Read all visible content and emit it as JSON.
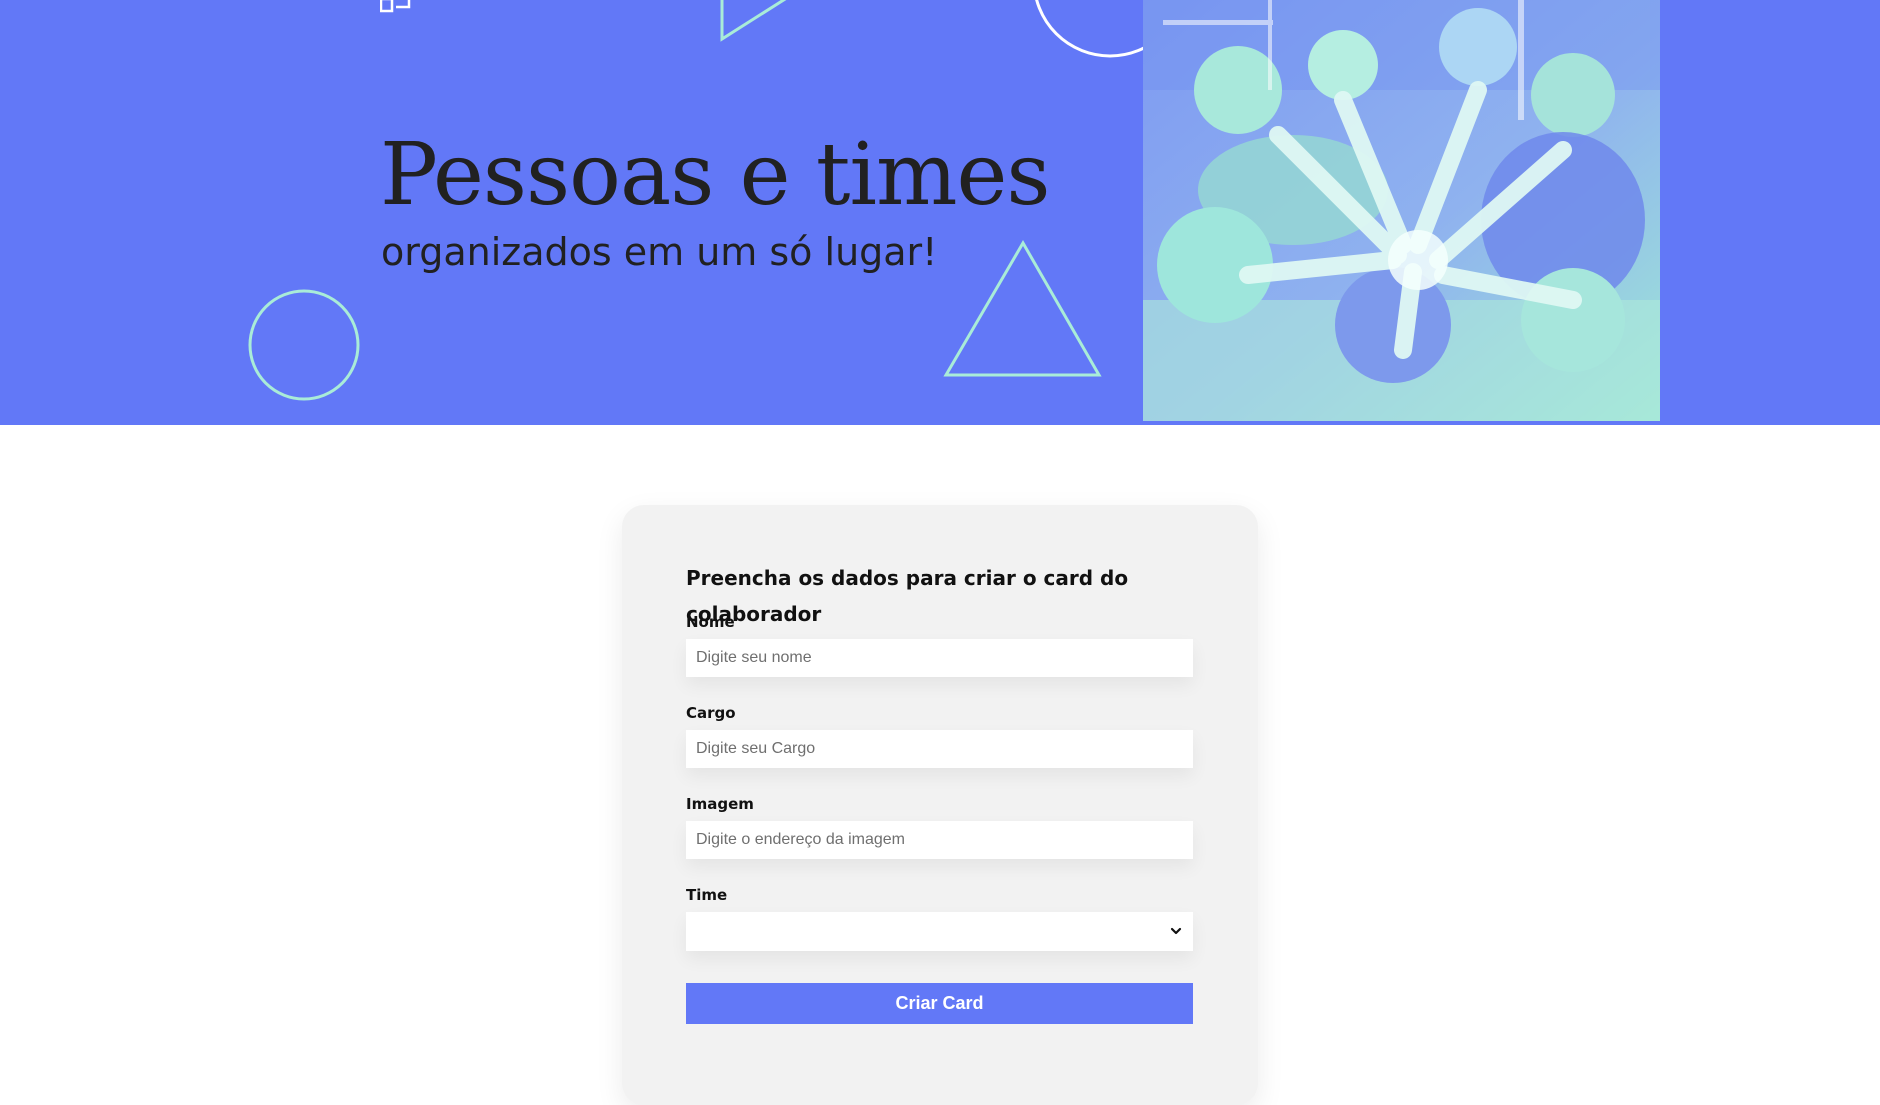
{
  "banner": {
    "title": "Pessoas e times",
    "subtitle": "organizados em um só lugar!",
    "background_color": "#6278f7",
    "accent_color": "#a9ecd8",
    "photo": "team-hands-together-photo"
  },
  "form": {
    "title": "Preencha os dados para criar o card do colaborador",
    "fields": [
      {
        "label": "Nome",
        "placeholder": "Digite seu nome",
        "value": ""
      },
      {
        "label": "Cargo",
        "placeholder": "Digite seu Cargo",
        "value": ""
      },
      {
        "label": "Imagem",
        "placeholder": "Digite o endereço da imagem",
        "value": ""
      }
    ],
    "team_select": {
      "label": "Time",
      "selected": ""
    },
    "submit_label": "Criar Card",
    "button_color": "#6278f7"
  },
  "icons": {
    "logo": "logo-icon",
    "select": "chevron-down-icon"
  }
}
